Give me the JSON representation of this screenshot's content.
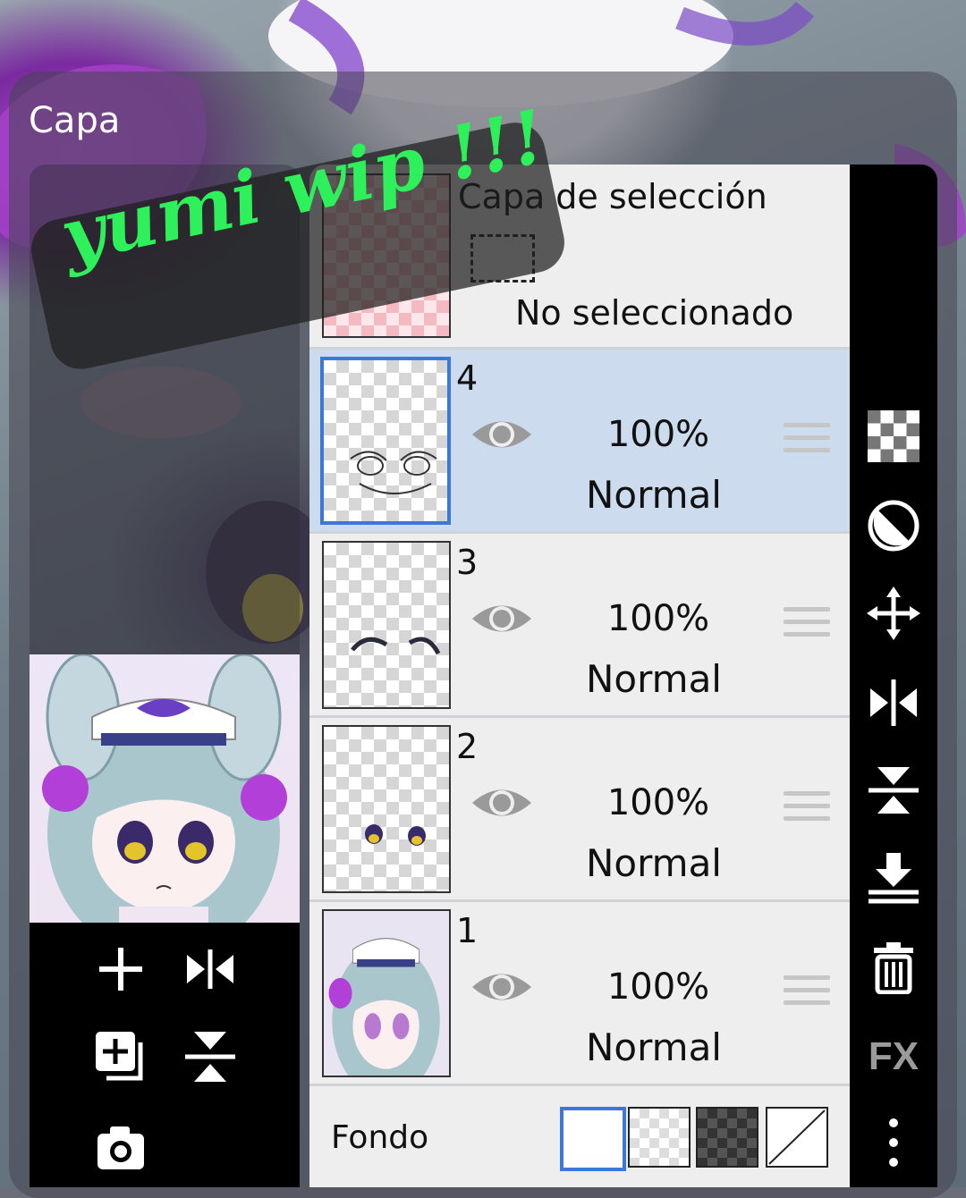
{
  "panel": {
    "title": "Capa"
  },
  "selection_layer": {
    "title": "Capa de selección",
    "status": "No seleccionado"
  },
  "layers": [
    {
      "number": "4",
      "opacity": "100%",
      "blend": "Normal",
      "selected": true
    },
    {
      "number": "3",
      "opacity": "100%",
      "blend": "Normal",
      "selected": false
    },
    {
      "number": "2",
      "opacity": "100%",
      "blend": "Normal",
      "selected": false
    },
    {
      "number": "1",
      "opacity": "100%",
      "blend": "Normal",
      "selected": false
    }
  ],
  "fondo": {
    "label": "Fondo",
    "options": [
      "white-swatch",
      "transparent-swatch",
      "dark-checker-swatch",
      "none-swatch"
    ],
    "selected": "white-swatch"
  },
  "right_toolbar": {
    "icons": [
      "checkerboard-icon",
      "half-circle-icon",
      "move-icon",
      "flip-horizontal-icon",
      "flip-vertical-icon",
      "merge-down-icon",
      "trash-icon",
      "fx-icon",
      "more-vertical-icon"
    ],
    "fx_label": "FX"
  },
  "left_toolbar": {
    "icons": [
      "add-layer-icon",
      "flip-horizontal-icon",
      "duplicate-layer-icon",
      "flip-vertical-icon",
      "camera-icon"
    ]
  },
  "overlay": {
    "text": "yumi wip !!!"
  },
  "colors": {
    "selected_row": "#cddbee",
    "selected_border": "#3b78d8",
    "sticker_text": "#2ef05a",
    "toolbar": "#000000"
  }
}
